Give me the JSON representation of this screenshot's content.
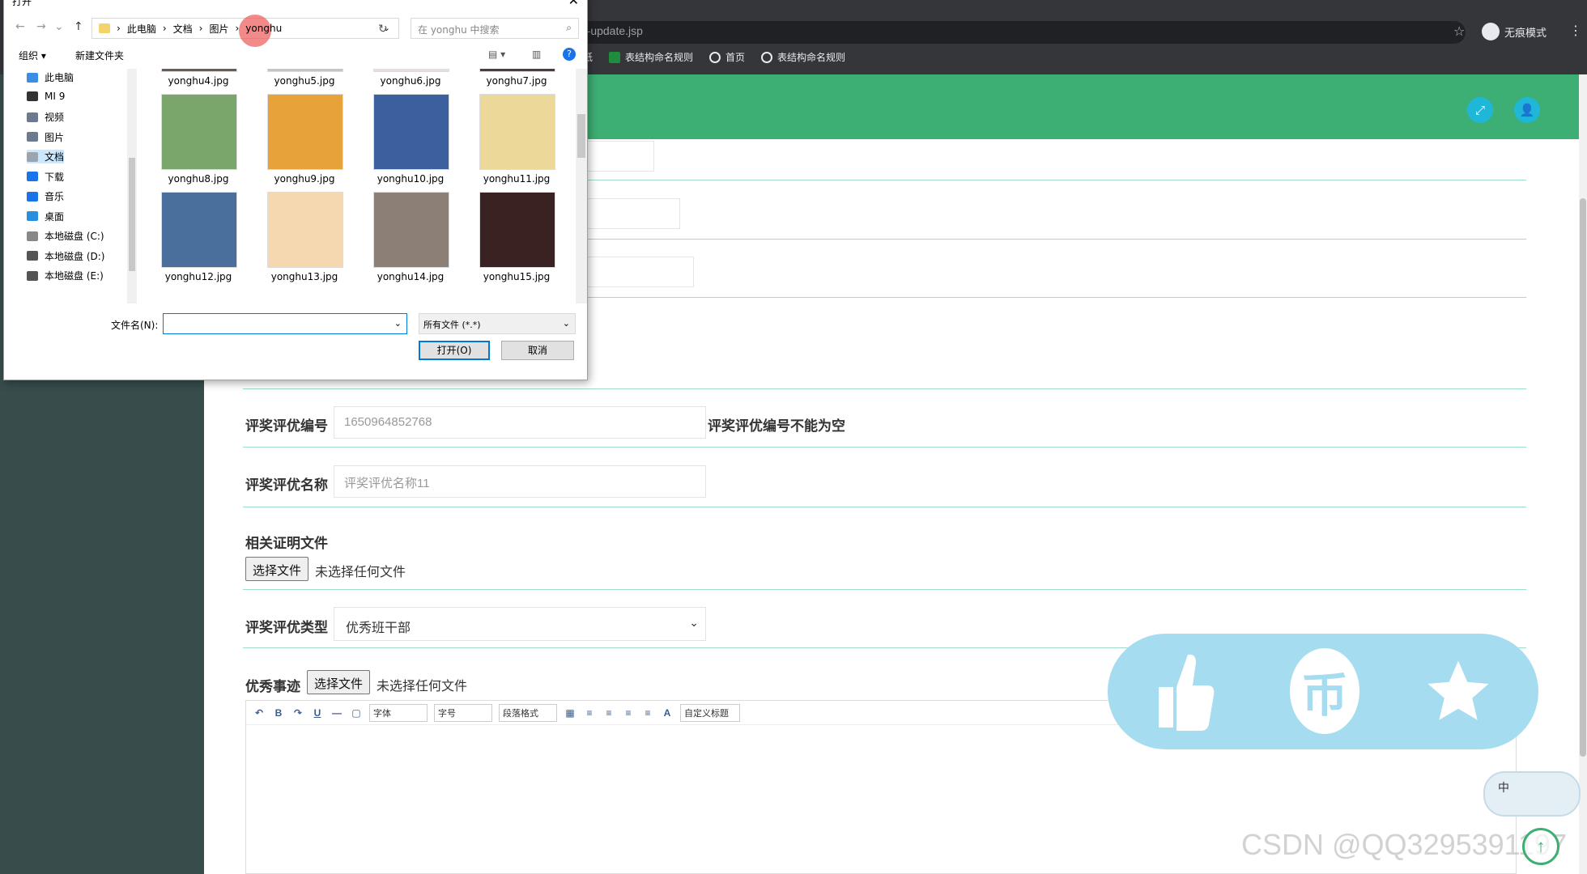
{
  "browser": {
    "address": "r-update.jsp",
    "incognito_label": "无痕模式",
    "bookmarks": [
      {
        "label": "纸"
      },
      {
        "label": "表结构命名规则"
      },
      {
        "label": "首页"
      },
      {
        "label": "表结构命名规则"
      }
    ]
  },
  "form": {
    "award_id": {
      "label": "评奖评优编号",
      "value": "1650964852768",
      "error": "评奖评优编号不能为空"
    },
    "award_name": {
      "label": "评奖评优名称",
      "placeholder": "评奖评优名称11"
    },
    "proof_file": {
      "label": "相关证明文件",
      "button": "选择文件",
      "status": "未选择任何文件"
    },
    "award_type": {
      "label": "评奖评优类型",
      "selected": "优秀班干部"
    },
    "deeds": {
      "label": "优秀事迹",
      "button": "选择文件",
      "status": "未选择任何文件"
    }
  },
  "editor_toolbar": {
    "font": "字体",
    "size": "字号",
    "paragraph": "段落格式",
    "custom_title": "自定义标题"
  },
  "ime": {
    "label": "中"
  },
  "watermark": "CSDN @QQ3295391197",
  "dialog": {
    "title": "打开",
    "breadcrumbs": [
      "此电脑",
      "文档",
      "图片"
    ],
    "current_folder": "yonghu",
    "search_placeholder": "在 yonghu 中搜索",
    "organize": "组织 ▾",
    "new_folder": "新建文件夹",
    "tree": [
      {
        "label": "此电脑",
        "color": "#3a8ee6"
      },
      {
        "label": "MI 9",
        "color": "#333333"
      },
      {
        "label": "视频",
        "color": "#6b7a8f"
      },
      {
        "label": "图片",
        "color": "#6b7a8f"
      },
      {
        "label": "文档",
        "color": "#9aa5b1"
      },
      {
        "label": "下载",
        "color": "#1a73e8"
      },
      {
        "label": "音乐",
        "color": "#1a73e8"
      },
      {
        "label": "桌面",
        "color": "#2a8ee0"
      },
      {
        "label": "本地磁盘 (C:)",
        "color": "#888888"
      },
      {
        "label": "本地磁盘 (D:)",
        "color": "#555555"
      },
      {
        "label": "本地磁盘 (E:)",
        "color": "#555555"
      }
    ],
    "files": [
      {
        "name": "yonghu4.jpg",
        "color": "#6b5a55"
      },
      {
        "name": "yonghu5.jpg",
        "color": "#c9c4c0"
      },
      {
        "name": "yonghu6.jpg",
        "color": "#e7dedc"
      },
      {
        "name": "yonghu7.jpg",
        "color": "#4a3d3a"
      },
      {
        "name": "yonghu8.jpg",
        "color": "#7aa66b"
      },
      {
        "name": "yonghu9.jpg",
        "color": "#e8a23a"
      },
      {
        "name": "yonghu10.jpg",
        "color": "#3c5f9e"
      },
      {
        "name": "yonghu11.jpg",
        "color": "#ecd99a"
      },
      {
        "name": "yonghu12.jpg",
        "color": "#4a6f9c"
      },
      {
        "name": "yonghu13.jpg",
        "color": "#f5d7b0"
      },
      {
        "name": "yonghu14.jpg",
        "color": "#8c7f76"
      },
      {
        "name": "yonghu15.jpg",
        "color": "#3b2222"
      }
    ],
    "filename_label": "文件名(N):",
    "filetype": "所有文件 (*.*)",
    "open_btn": "打开(O)",
    "cancel_btn": "取消"
  },
  "colors": {
    "header_green": "#3dae74",
    "sidebar": "#384c4c",
    "widget_blue": "#a6dcef"
  }
}
